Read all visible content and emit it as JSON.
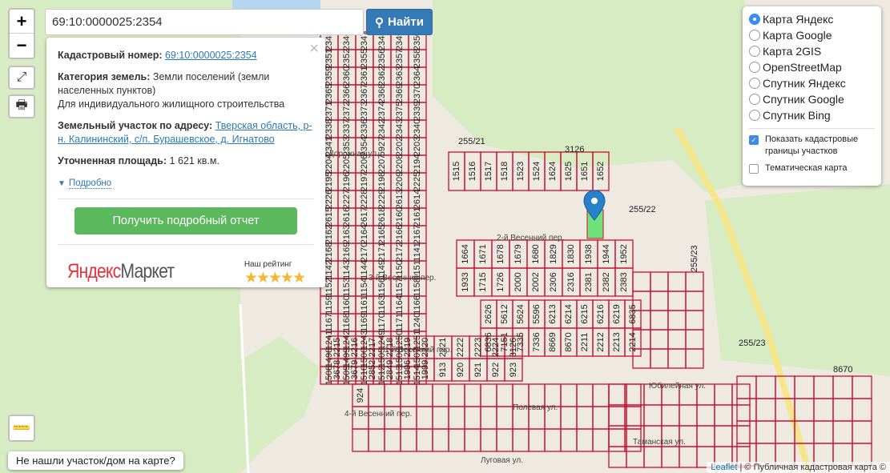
{
  "search": {
    "value": "69:10:0000025:2354",
    "button": "Найти"
  },
  "zoom": {
    "in": "+",
    "out": "−"
  },
  "popup": {
    "cadastral_label": "Кадастровый номер:",
    "cadastral_value": "69:10:0000025:2354",
    "category_label": "Категория земель:",
    "category_value": "Земли поселений (земли населенных пунктов)",
    "usage": "Для индивидуального жилищного строительства",
    "address_label": "Земельный участок по адресу:",
    "address_value": "Тверская область, р-н. Калининский, с/п. Бурашевское, д. Игнатово",
    "area_label": "Уточненная площадь:",
    "area_value": "1 621 кв.м.",
    "more": "Подробно",
    "report_button": "Получить подробный отчет",
    "market_logo": "Яндекс Маркет",
    "rating_label": "Наш рейтинг",
    "rating": 5,
    "close": "×"
  },
  "layers": {
    "options": [
      "Карта Яндекс",
      "Карта Google",
      "Карта 2GIS",
      "OpenStreetMap",
      "Спутник Яндекс",
      "Спутник Google",
      "Спутник Bing"
    ],
    "selected": 0,
    "show_borders": "Показать кадастровые границы участков",
    "show_borders_checked": true,
    "thematic": "Тематическая карта",
    "thematic_checked": false
  },
  "not_found": "Не нашли участок/дом на карте?",
  "attribution": {
    "leaflet": "Leaflet",
    "text": "| © Публичная кадастровая карта ©"
  },
  "map": {
    "parcels": [
      "2345",
      "2346",
      "2347",
      "2348",
      "2349",
      "2350",
      "2351",
      "2352",
      "2355",
      "2356",
      "2357",
      "2358",
      "2359",
      "2360",
      "2361",
      "2362",
      "2363",
      "2364",
      "2365",
      "2366",
      "2367",
      "2368",
      "2369",
      "2370",
      "2371",
      "2372",
      "2373",
      "2374",
      "2375",
      "2339",
      "2338",
      "2337",
      "2336",
      "2342",
      "2343",
      "2340",
      "2341",
      "2353",
      "2354",
      "5927",
      "2202",
      "2203",
      "2204",
      "2205",
      "2206",
      "2207",
      "2208",
      "2194",
      "2195",
      "2196",
      "2197",
      "2198",
      "2209",
      "2225",
      "2226",
      "2227",
      "2228",
      "2229",
      "2613",
      "2614",
      "2615",
      "2616",
      "2617",
      "2618",
      "2160",
      "2161",
      "2162",
      "2163",
      "2164",
      "2165",
      "2166",
      "2167",
      "2168",
      "2169",
      "2170",
      "2171",
      "2172",
      "1141",
      "1142",
      "1143",
      "1144",
      "1149",
      "1150",
      "1151",
      "1152",
      "1153",
      "1154",
      "1156",
      "1157",
      "1158",
      "1159",
      "1160",
      "1161",
      "1163",
      "1164",
      "1166",
      "1167",
      "1168",
      "1169",
      "1170",
      "1171",
      "1240",
      "1241",
      "1242",
      "1243",
      "1249",
      "1250",
      "1251",
      "1498",
      "1499",
      "1500",
      "1505",
      "1506",
      "1507",
      "1508",
      "1509",
      "1510",
      "1512",
      "1513",
      "1514",
      "1515",
      "1516",
      "1517",
      "1518",
      "1523",
      "1524",
      "1624",
      "1625",
      "1651",
      "1652",
      "1664",
      "1671",
      "1678",
      "1679",
      "1680",
      "1829",
      "1830",
      "1938",
      "1944",
      "1952",
      "1933",
      "1715",
      "1726",
      "2000",
      "2002",
      "2306",
      "2316",
      "2381",
      "2382",
      "2383",
      "2626",
      "5612",
      "5624",
      "5596",
      "6213",
      "6214",
      "6215",
      "6216",
      "6219",
      "6835",
      "6836",
      "7151",
      "7335",
      "7336",
      "8669",
      "8670",
      "2211",
      "2212",
      "2213",
      "2214",
      "2215",
      "2216",
      "2217",
      "2218",
      "2219",
      "2220",
      "2221",
      "2222",
      "2223",
      "2224",
      "3126",
      "3678",
      "3679",
      "2852",
      "2849",
      "1996",
      "1999",
      "913",
      "920",
      "921",
      "922",
      "923",
      "924"
    ],
    "big_labels": [
      "255/21",
      "255/22",
      "255/23",
      "255/23",
      "3126",
      "8670"
    ],
    "streets": [
      "2-й Весенний пер.",
      "1-й Весенний пер.",
      "3-й Весенний пер.",
      "4-й Весенний пер.",
      "Полевая ул.",
      "Луговая ул.",
      "Таманская ул.",
      "Юбилейная ул.",
      "Дорожная ул."
    ],
    "selected_parcel": "2354"
  }
}
